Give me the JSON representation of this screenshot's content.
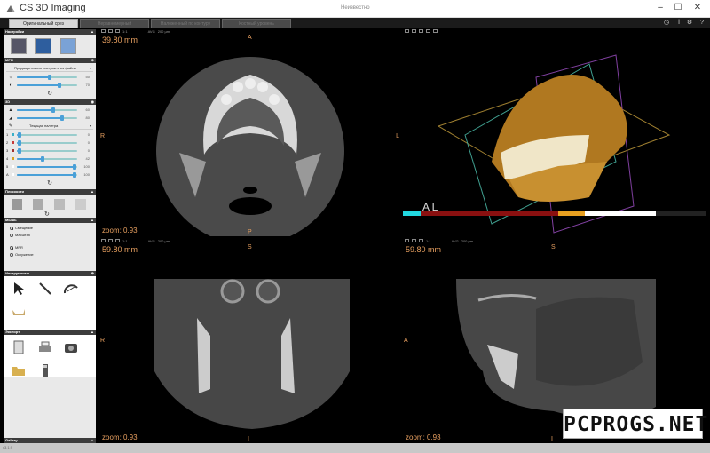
{
  "app": {
    "title": "CS 3D Imaging",
    "document": "Неизвестно",
    "version": "v3.1.9"
  },
  "tabs": [
    {
      "label": "Оригинальный срез",
      "active": true
    },
    {
      "label": "Неравномерный"
    },
    {
      "label": "Наложенный по контуру"
    },
    {
      "label": "Костный уровень"
    }
  ],
  "panel": {
    "settings": {
      "title": "Настройки"
    },
    "mpr": {
      "title": "MPR",
      "preset": "Предварительно настроить из файла",
      "brightness": {
        "value": 50,
        "fill": 0.55
      },
      "contrast": {
        "value": 70,
        "fill": 0.7
      }
    },
    "three_d": {
      "title": "3D",
      "row1": {
        "value": 60,
        "fill": 0.6
      },
      "row2": {
        "value": 80,
        "fill": 0.75
      },
      "palette": "Текущая палитра",
      "channels": [
        {
          "label": "1",
          "color": "#3ab0c8",
          "value": 0,
          "fill": 0.05
        },
        {
          "label": "2",
          "color": "#c83a3a",
          "value": 0,
          "fill": 0.05
        },
        {
          "label": "3",
          "color": "#a03030",
          "value": 0,
          "fill": 0.05
        },
        {
          "label": "4",
          "color": "#d8a020",
          "value": 42,
          "fill": 0.42
        },
        {
          "label": "5",
          "color": "#ffffff",
          "value": 100,
          "fill": 0.95
        },
        {
          "label": "A",
          "color": "#ffffff",
          "value": 100,
          "fill": 0.95
        }
      ]
    },
    "planes": {
      "title": "Плоскости"
    },
    "mouse": {
      "title": "Мышь",
      "group1": [
        {
          "label": "Смещение",
          "on": true
        },
        {
          "label": "Масштаб",
          "on": false
        }
      ],
      "group2": [
        {
          "label": "MPR",
          "on": true
        },
        {
          "label": "Окружение",
          "on": false
        }
      ]
    },
    "tools": {
      "title": "Инструменты"
    },
    "export": {
      "title": "Экспорт"
    },
    "gallery": {
      "title": "Gallery"
    }
  },
  "views": {
    "axial": {
      "mm": "39.80 mm",
      "zoom": "zoom: 0.93",
      "top": "A",
      "bottom": "P",
      "left": "R",
      "right": "L"
    },
    "volume": {
      "text": "A L"
    },
    "coronal": {
      "mm": "59.80 mm",
      "zoom": "zoom: 0.93",
      "top": "S",
      "bottom": "I",
      "left": "R"
    },
    "sagittal": {
      "mm": "59.80 mm",
      "zoom": "zoom: 0.93",
      "top": "S",
      "bottom": "I",
      "left": "A"
    }
  },
  "viewtool": {
    "ratio": "1:1",
    "mode": "AVG",
    "um": "200 µm"
  },
  "watermark": "PCPROGS.NET"
}
